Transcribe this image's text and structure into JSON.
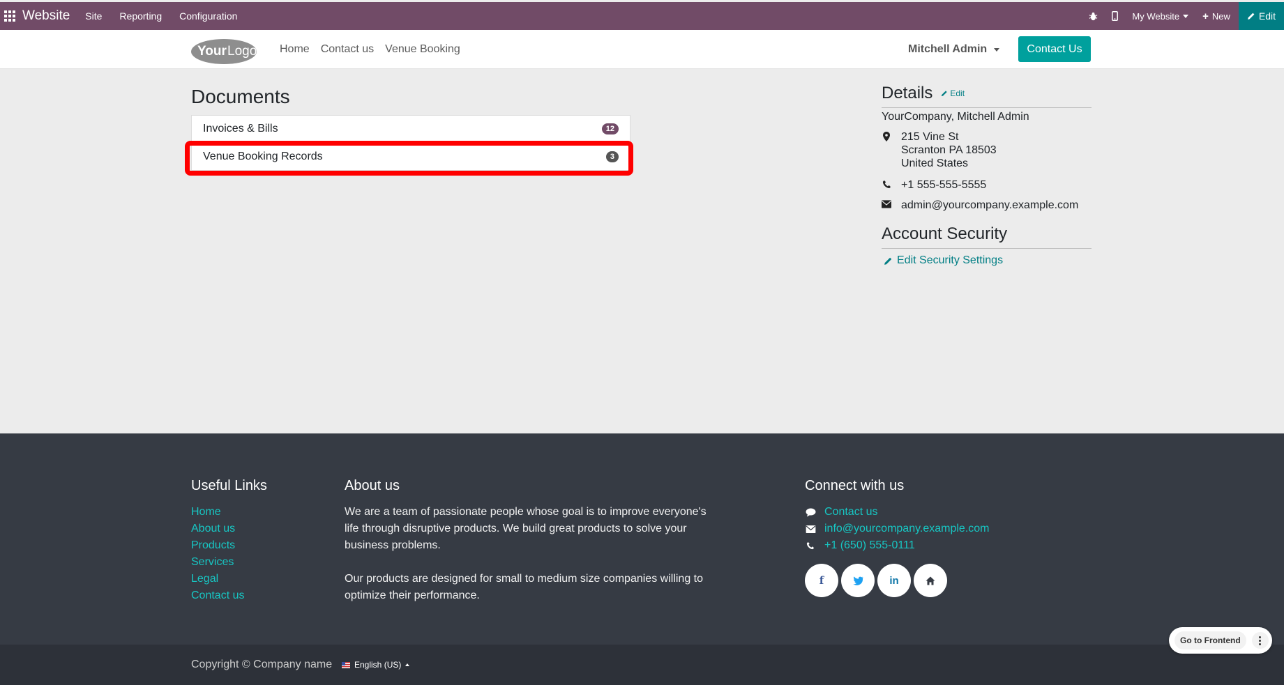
{
  "topbar": {
    "brand": "Website",
    "menus": [
      "Site",
      "Reporting",
      "Configuration"
    ],
    "my_website": "My Website",
    "new_label": "New",
    "edit_label": "Edit",
    "accent": "#714b67"
  },
  "header": {
    "logo_text": "YourLogo",
    "nav": [
      "Home",
      "Contact us",
      "Venue Booking"
    ],
    "user": "Mitchell Admin",
    "contact_button": "Contact Us"
  },
  "documents": {
    "title": "Documents",
    "items": [
      {
        "label": "Invoices & Bills",
        "count": "12"
      },
      {
        "label": "Venue Booking Records",
        "count": "3"
      }
    ]
  },
  "details": {
    "title": "Details",
    "edit_label": "Edit",
    "company": "YourCompany, Mitchell Admin",
    "address": [
      "215 Vine St",
      "Scranton PA 18503",
      "United States"
    ],
    "phone": "+1 555-555-5555",
    "email": "admin@yourcompany.example.com"
  },
  "account_security": {
    "title": "Account Security",
    "link": "Edit Security Settings"
  },
  "footer": {
    "useful_links": {
      "title": "Useful Links",
      "links": [
        "Home",
        "About us",
        "Products",
        "Services",
        "Legal",
        "Contact us"
      ]
    },
    "about": {
      "title": "About us",
      "p1": "We are a team of passionate people whose goal is to improve everyone's life through disruptive products. We build great products to solve your business problems.",
      "p2": "Our products are designed for small to medium size companies willing to optimize their performance."
    },
    "connect": {
      "title": "Connect with us",
      "contact": "Contact us",
      "email": "info@yourcompany.example.com",
      "phone": "+1 (650) 555-0111",
      "socials": [
        "facebook-icon",
        "twitter-icon",
        "linkedin-icon",
        "home-icon"
      ]
    },
    "copyright": "Copyright © Company name",
    "language": "English (US)"
  },
  "goto_frontend": "Go to Frontend"
}
